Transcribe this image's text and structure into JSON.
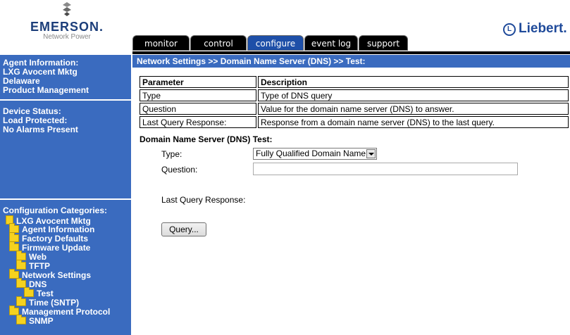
{
  "header": {
    "emerson_brand": "EMERSON.",
    "emerson_sub": "Network Power",
    "liebert_brand": "Liebert."
  },
  "tabs": [
    {
      "label": "monitor",
      "active": false
    },
    {
      "label": "control",
      "active": false
    },
    {
      "label": "configure",
      "active": true
    },
    {
      "label": "event log",
      "active": false
    },
    {
      "label": "support",
      "active": false
    }
  ],
  "sidebar": {
    "agent_info_title": "Agent Information:",
    "agent_info_lines": [
      "LXG Avocent Mktg",
      "Delaware",
      "Product Management"
    ],
    "device_status_title": "Device Status:",
    "device_status_lines": [
      "Load Protected:",
      "No Alarms Present"
    ],
    "config_title": "Configuration Categories:",
    "tree": [
      {
        "label": "LXG Avocent Mktg",
        "icon": "root-icon",
        "level": 0
      },
      {
        "label": "Agent Information",
        "icon": "folder-icon",
        "level": 1
      },
      {
        "label": "Factory Defaults",
        "icon": "folder-icon",
        "level": 1
      },
      {
        "label": "Firmware Update",
        "icon": "folder-icon",
        "level": 1
      },
      {
        "label": "Web",
        "icon": "folder-icon",
        "level": 2
      },
      {
        "label": "TFTP",
        "icon": "folder-icon",
        "level": 2
      },
      {
        "label": "Network Settings",
        "icon": "folder-icon",
        "level": 1
      },
      {
        "label": "DNS",
        "icon": "folder-icon",
        "level": 2
      },
      {
        "label": "Test",
        "icon": "folder-icon",
        "level": 3
      },
      {
        "label": "Time (SNTP)",
        "icon": "folder-icon",
        "level": 2
      },
      {
        "label": "Management Protocol",
        "icon": "folder-icon",
        "level": 1
      },
      {
        "label": "SNMP",
        "icon": "folder-icon",
        "level": 2
      }
    ]
  },
  "main": {
    "breadcrumb": "Network Settings >> Domain Name Server (DNS) >> Test:",
    "table": {
      "headers": [
        "Parameter",
        "Description"
      ],
      "rows": [
        [
          "Type",
          "Type of DNS query"
        ],
        [
          "Question",
          "Value for the domain name server (DNS) to answer."
        ],
        [
          "Last Query Response:",
          "Response from a domain name server (DNS) to the last query."
        ]
      ]
    },
    "test_title": "Domain Name Server (DNS) Test:",
    "type_label": "Type:",
    "type_value": "Fully Qualified Domain Name",
    "question_label": "Question:",
    "question_value": "",
    "last_response_label": "Last Query Response:",
    "query_button": "Query..."
  },
  "colors": {
    "sidebar_bg": "#3a6bbf",
    "active_tab": "#1e4fa8",
    "folder": "#f5d21f"
  }
}
